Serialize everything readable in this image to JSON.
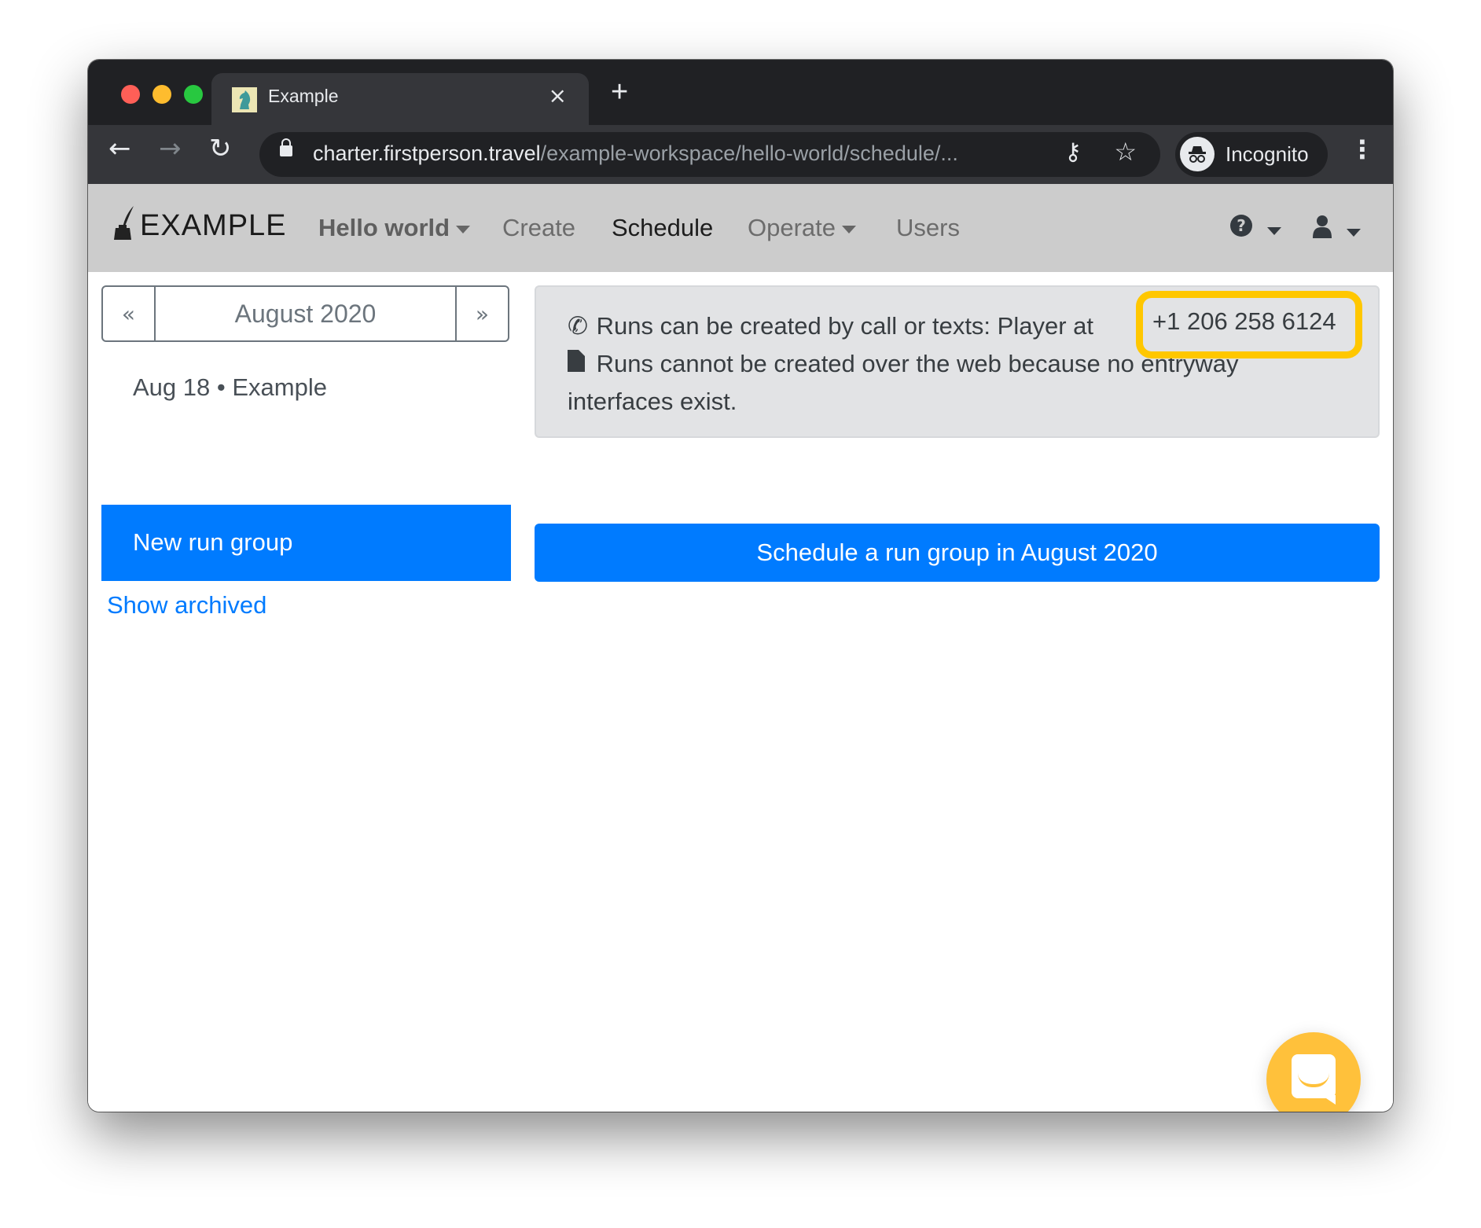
{
  "window": {
    "tab": {
      "title": "Example",
      "favicon": "chess-knight-icon",
      "close_icon": "×"
    },
    "new_tab_icon": "+",
    "toolbar": {
      "back_icon": "←",
      "forward_icon": "→",
      "reload_icon": "↻",
      "url_host": "charter.firstperson.travel",
      "url_path": "/example-workspace/hello-world/schedule/...",
      "key_icon": "⚷",
      "star_icon": "☆",
      "profile_label": "Incognito",
      "profile_icon": "🕶",
      "menu_icon": "⋮"
    }
  },
  "navbar": {
    "brand": "EXAMPLE",
    "brand_icon": "✒",
    "project": "Hello world",
    "items": [
      {
        "label": "Create"
      },
      {
        "label": "Schedule",
        "active": true
      },
      {
        "label": "Operate"
      },
      {
        "label": "Users"
      }
    ],
    "help_icon": "?",
    "user_icon": "👤"
  },
  "sidebar": {
    "prev_label": "«",
    "month": "August 2020",
    "next_label": "»",
    "run_item": "Aug 18 • Example",
    "new_run_group": "New run group",
    "show_archived": "Show archived"
  },
  "main": {
    "alert_line1": "Runs can be created by call or texts: Player at",
    "phone_number": "+1 206 258 6124",
    "alert_line2": "Runs cannot be created over the web because no entryway interfaces exist.",
    "phone_icon": "✆",
    "document_icon": "▙",
    "schedule_button": "Schedule a run group in August 2020"
  },
  "colors": {
    "primary": "#007bff",
    "highlight": "#ffc700",
    "chat": "#ffc13b"
  }
}
